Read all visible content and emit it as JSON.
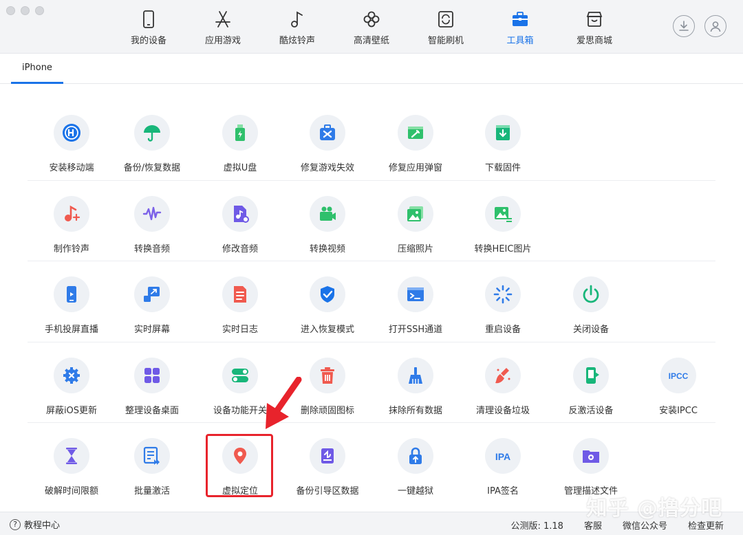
{
  "nav": {
    "items": [
      {
        "label": "我的设备",
        "icon": "phone-icon"
      },
      {
        "label": "应用游戏",
        "icon": "app-store-icon"
      },
      {
        "label": "酷炫铃声",
        "icon": "music-note-icon"
      },
      {
        "label": "高清壁纸",
        "icon": "flower-icon"
      },
      {
        "label": "智能刷机",
        "icon": "refresh-box-icon"
      },
      {
        "label": "工具箱",
        "icon": "toolbox-icon"
      },
      {
        "label": "爱思商城",
        "icon": "store-icon"
      }
    ],
    "active_index": 5
  },
  "subtab": {
    "label": "iPhone"
  },
  "tools": {
    "row1": [
      {
        "label": "安装移动端",
        "icon": "i4-logo-icon",
        "color": "#1a73e8"
      },
      {
        "label": "备份/恢复数据",
        "icon": "umbrella-icon",
        "color": "#18b67a"
      },
      {
        "label": "虚拟U盘",
        "icon": "usb-drive-icon",
        "color": "#2fc06c"
      },
      {
        "label": "修复游戏失效",
        "icon": "game-repair-icon",
        "color": "#2f7be8"
      },
      {
        "label": "修复应用弹窗",
        "icon": "app-repair-icon",
        "color": "#2fc06c"
      },
      {
        "label": "下载固件",
        "icon": "download-firmware-icon",
        "color": "#18b67a"
      }
    ],
    "row2": [
      {
        "label": "制作铃声",
        "icon": "ringtone-icon",
        "color": "#f05a4f"
      },
      {
        "label": "转换音频",
        "icon": "audio-wave-icon",
        "color": "#7b61e8"
      },
      {
        "label": "修改音频",
        "icon": "edit-audio-icon",
        "color": "#6f5ae6"
      },
      {
        "label": "转换视频",
        "icon": "video-camera-icon",
        "color": "#2fc06c"
      },
      {
        "label": "压缩照片",
        "icon": "photo-icon",
        "color": "#2fc06c"
      },
      {
        "label": "转换HEIC图片",
        "icon": "heic-photo-icon",
        "color": "#2fc06c"
      }
    ],
    "row3": [
      {
        "label": "手机投屏直播",
        "icon": "screen-cast-icon",
        "color": "#2f7be8"
      },
      {
        "label": "实时屏幕",
        "icon": "realtime-screen-icon",
        "color": "#2f7be8"
      },
      {
        "label": "实时日志",
        "icon": "log-icon",
        "color": "#f05a4f"
      },
      {
        "label": "进入恢复模式",
        "icon": "shield-check-icon",
        "color": "#1a73e8"
      },
      {
        "label": "打开SSH通道",
        "icon": "terminal-icon",
        "color": "#2f7be8"
      },
      {
        "label": "重启设备",
        "icon": "restart-icon",
        "color": "#2f7be8"
      },
      {
        "label": "关闭设备",
        "icon": "power-icon",
        "color": "#18b67a"
      }
    ],
    "row4": [
      {
        "label": "屏蔽iOS更新",
        "icon": "gear-block-icon",
        "color": "#2f7be8"
      },
      {
        "label": "整理设备桌面",
        "icon": "grid-icon",
        "color": "#6f5ae6"
      },
      {
        "label": "设备功能开关",
        "icon": "toggle-icon",
        "color": "#18b67a"
      },
      {
        "label": "删除顽固图标",
        "icon": "trash-icon",
        "color": "#f05a4f"
      },
      {
        "label": "抹除所有数据",
        "icon": "broom-icon",
        "color": "#2f7be8"
      },
      {
        "label": "清理设备垃圾",
        "icon": "clean-brush-icon",
        "color": "#f05a4f"
      },
      {
        "label": "反激活设备",
        "icon": "deactivate-phone-icon",
        "color": "#18b67a"
      },
      {
        "label": "安装IPCC",
        "icon": "ipcc-icon",
        "color": "#2f7be8",
        "text": "IPCC"
      }
    ],
    "row5": [
      {
        "label": "破解时间限额",
        "icon": "hourglass-icon",
        "color": "#6f5ae6"
      },
      {
        "label": "批量激活",
        "icon": "batch-activate-icon",
        "color": "#2f7be8"
      },
      {
        "label": "虚拟定位",
        "icon": "location-pin-icon",
        "color": "#f05a4f"
      },
      {
        "label": "备份引导区数据",
        "icon": "backup-boot-icon",
        "color": "#6f5ae6"
      },
      {
        "label": "一键越狱",
        "icon": "unlock-icon",
        "color": "#2f7be8"
      },
      {
        "label": "IPA签名",
        "icon": "ipa-icon",
        "color": "#2f7be8",
        "text": "IPA"
      },
      {
        "label": "管理描述文件",
        "icon": "profile-folder-icon",
        "color": "#6f5ae6"
      }
    ]
  },
  "bottom": {
    "help": "教程中心",
    "version": "公测版: 1.18",
    "service": "客服",
    "wechat": "微信公众号",
    "update": "检查更新"
  },
  "watermark": "知乎 @撸分吧"
}
